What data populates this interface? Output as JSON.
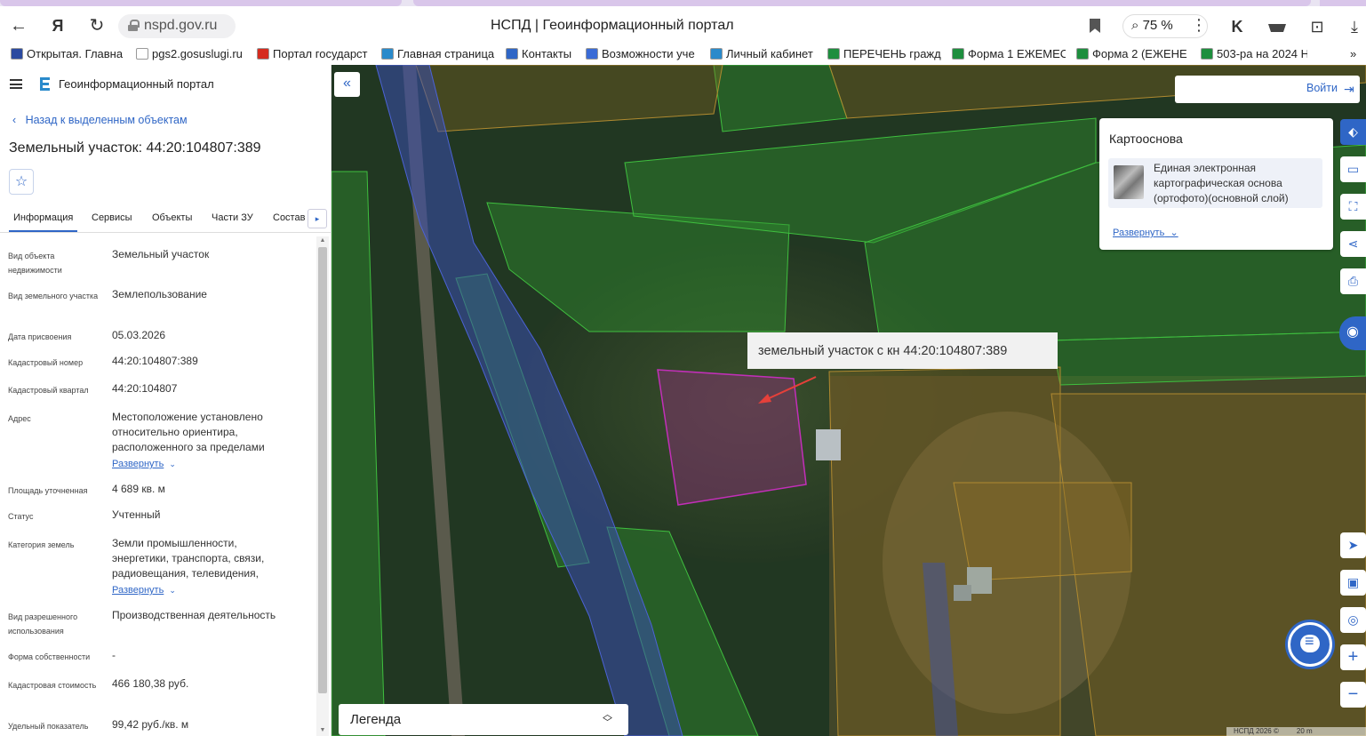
{
  "browser": {
    "url": "nspd.gov.ru",
    "page_title": "НСПД | Геоинформационный портал",
    "zoom": "75 %",
    "bookmarks": [
      {
        "label": "Открытая. Главна",
        "color": "#2b4aa0"
      },
      {
        "label": "pgs2.gosuslugi.ru",
        "color": "#ffffff"
      },
      {
        "label": "Портал государст",
        "color": "#d52b1e"
      },
      {
        "label": "Главная страница",
        "color": "#2a8acb"
      },
      {
        "label": "Контакты",
        "color": "#2f66c6"
      },
      {
        "label": "Возможности уче",
        "color": "#3a6bd6"
      },
      {
        "label": "Личный кабинет",
        "color": "#2a8acb"
      },
      {
        "label": "ПЕРЕЧЕНЬ гражд",
        "color": "#1e8e3e"
      },
      {
        "label": "Форма 1 ЕЖЕМЕС",
        "color": "#1e8e3e"
      },
      {
        "label": "Форма 2 (ЕЖЕНЕ",
        "color": "#1e8e3e"
      },
      {
        "label": "503-ра на 2024 Н",
        "color": "#1e8e3e"
      }
    ],
    "more_bookmarks": "»"
  },
  "panel": {
    "portal_name": "Геоинформационный портал",
    "back_link": "Назад к выделенным объектам",
    "title": "Земельный участок: 44:20:104807:389",
    "tabs": [
      "Информация",
      "Сервисы",
      "Объекты",
      "Части ЗУ",
      "Состав"
    ],
    "expand_label": "Развернуть",
    "rows": [
      {
        "label": "Вид объекта недвижимости",
        "value": "Земельный участок"
      },
      {
        "label": "Вид земельного участка",
        "value": "Землепользование"
      },
      {
        "label": "Дата присвоения",
        "value": "05.03.2026"
      },
      {
        "label": "Кадастровый номер",
        "value": "44:20:104807:389"
      },
      {
        "label": "Кадастровый квартал",
        "value": "44:20:104807"
      },
      {
        "label": "Адрес",
        "value": "Местоположение установлено относительно ориентира, расположенного за пределами"
      },
      {
        "label": "Площадь уточненная",
        "value": "4 689 кв. м"
      },
      {
        "label": "Статус",
        "value": "Учтенный"
      },
      {
        "label": "Категория земель",
        "value": "Земли промышленности, энергетики, транспорта, связи, радиовещания, телевидения,"
      },
      {
        "label": "Вид разрешенного использования",
        "value": "Производственная деятельность"
      },
      {
        "label": "Форма собственности",
        "value": "-"
      },
      {
        "label": "Кадастровая стоимость",
        "value": "466 180,38 руб."
      },
      {
        "label": "Удельный показатель",
        "value": "99,42 руб./кв. м"
      }
    ]
  },
  "map": {
    "login": "Войти",
    "basemap_title": "Картооснова",
    "basemap_layer": "Единая электронная картографическая основа (ортофото)(основной слой)",
    "basemap_expand": "Развернуть",
    "annotation": "земельный участок с кн 44:20:104807:389",
    "legend": "Легенда",
    "attribution": "НСПД 2026 ©",
    "scale": "20 m",
    "colors": {
      "accent": "#2f66c6",
      "parcel_outline": "#c22fb8",
      "forest_zone": "#2f8f2f",
      "water_zone": "#3a4fb0",
      "industrial_zone": "#8a6a1f"
    }
  }
}
